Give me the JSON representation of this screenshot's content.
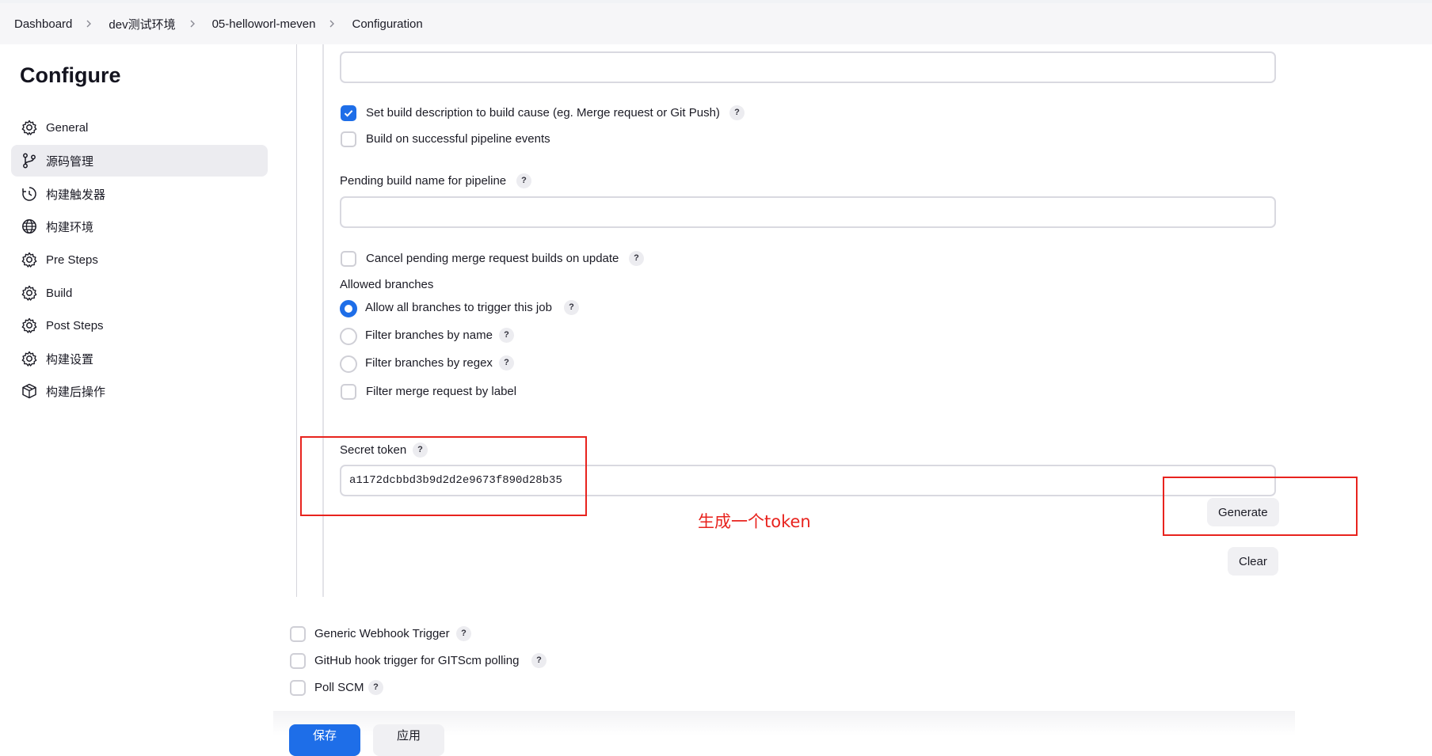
{
  "breadcrumb": [
    "Dashboard",
    "dev测试环境",
    "05-helloworl-meven",
    "Configuration"
  ],
  "sidebar": {
    "title": "Configure",
    "items": [
      {
        "label": "General",
        "icon": "gear-icon"
      },
      {
        "label": "源码管理",
        "icon": "branch-icon",
        "active": true
      },
      {
        "label": "构建触发器",
        "icon": "clock-icon"
      },
      {
        "label": "构建环境",
        "icon": "globe-icon"
      },
      {
        "label": "Pre Steps",
        "icon": "gear-icon"
      },
      {
        "label": "Build",
        "icon": "gear-icon"
      },
      {
        "label": "Post Steps",
        "icon": "gear-icon"
      },
      {
        "label": "构建设置",
        "icon": "gear-icon"
      },
      {
        "label": "构建后操作",
        "icon": "cube-icon"
      }
    ]
  },
  "form": {
    "set_build_description": {
      "label": "Set build description to build cause (eg. Merge request or Git Push)",
      "checked": true
    },
    "build_on_pipeline": {
      "label": "Build on successful pipeline events",
      "checked": false
    },
    "pending_build_name": {
      "label": "Pending build name for pipeline",
      "value": ""
    },
    "cancel_pending": {
      "label": "Cancel pending merge request builds on update",
      "checked": false
    },
    "allowed_branches": {
      "label": "Allowed branches",
      "options": [
        {
          "label": "Allow all branches to trigger this job",
          "selected": true
        },
        {
          "label": "Filter branches by name",
          "selected": false
        },
        {
          "label": "Filter branches by regex",
          "selected": false
        }
      ]
    },
    "filter_by_label": {
      "label": "Filter merge request by label",
      "checked": false
    },
    "secret_token": {
      "label": "Secret token",
      "value": "a1172dcbbd3b9d2d2e9673f890d28b35"
    },
    "generate_label": "Generate",
    "clear_label": "Clear",
    "help_glyph": "?"
  },
  "triggers": [
    {
      "label": "Generic Webhook Trigger",
      "checked": false
    },
    {
      "label": "GitHub hook trigger for GITScm polling",
      "checked": false
    },
    {
      "label": "Poll SCM",
      "checked": false
    }
  ],
  "annotation": {
    "text": "生成一个token",
    "color": "#e8231e"
  },
  "footer": {
    "save_label": "保存",
    "apply_label": "应用"
  },
  "colors": {
    "accent": "#1e6ee8",
    "annotation_red": "#e8231e"
  }
}
